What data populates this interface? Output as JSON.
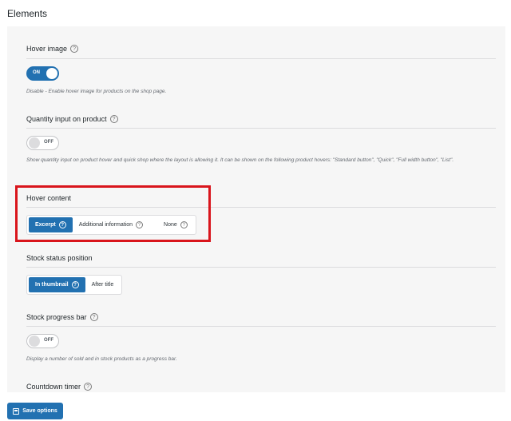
{
  "header": {
    "title": "Elements"
  },
  "options": {
    "hover_image": {
      "title": "Hover image",
      "toggle": "ON",
      "description": "Disable - Enable hover image for products on the shop page."
    },
    "quantity_input": {
      "title": "Quantity input on product",
      "toggle": "OFF",
      "description": "Show quantity input on product hover and quick shop where the layout is allowing it. It can be shown on the following product hovers: \"Standard button\", \"Quick\", \"Full width button\", \"List\"."
    },
    "hover_content": {
      "title": "Hover content",
      "choices": [
        {
          "label": "Excerpt",
          "selected": true
        },
        {
          "label": "Additional information",
          "selected": false
        },
        {
          "label": "None",
          "selected": false
        }
      ]
    },
    "stock_status_position": {
      "title": "Stock status position",
      "choices": [
        {
          "label": "In thumbnail",
          "selected": true
        },
        {
          "label": "After title",
          "selected": false
        }
      ]
    },
    "stock_progress_bar": {
      "title": "Stock progress bar",
      "toggle": "OFF",
      "description": "Display a number of sold and in stock products as a progress bar."
    },
    "countdown_timer": {
      "title": "Countdown timer"
    }
  },
  "footer": {
    "save_label": "Save options"
  },
  "colors": {
    "accent": "#2271b1",
    "highlight": "#d9151c",
    "panel_bg": "#f6f6f6"
  }
}
